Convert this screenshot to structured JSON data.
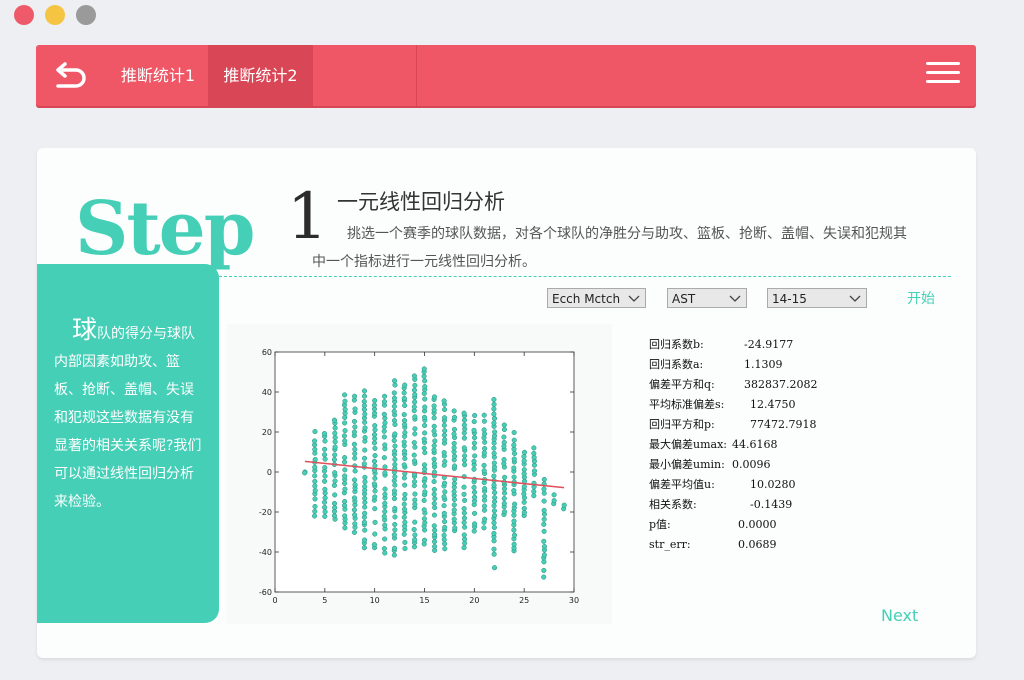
{
  "nav": {
    "tabs": [
      {
        "label": "推断统计1"
      },
      {
        "label": "推断统计2"
      }
    ]
  },
  "step": {
    "word": "Step",
    "number": "1",
    "title": "一元线性回归分析",
    "description": "挑选一个赛季的球队数据，对各个球队的净胜分与助攻、篮板、抢断、盖帽、失误和犯规其中一个指标进行一元线性回归分析。"
  },
  "side": {
    "first_char": "球",
    "text_rest": "队的得分与球队内部因素如助攻、篮板、抢断、盖帽、失误和犯规这些数据有没有显著的相关关系呢?我们可以通过线性回归分析来检验。"
  },
  "controls": {
    "match": "Ecch Mctch",
    "stat": "AST",
    "season": "14-15",
    "start": "开始"
  },
  "stats": [
    {
      "label": "回归系数b:",
      "value": "-24.9177"
    },
    {
      "label": "回归系数a:",
      "value": "1.1309"
    },
    {
      "label": "偏差平方和q:",
      "value": "382837.2082"
    },
    {
      "label": "平均标准偏差s:",
      "value": "12.4750"
    },
    {
      "label": "回归平方和p:",
      "value": "77472.7918"
    },
    {
      "label": "最大偏差umax:",
      "value": "44.6168"
    },
    {
      "label": "最小偏差umin:",
      "value": "0.0096"
    },
    {
      "label": "偏差平均值u:",
      "value": "10.0280"
    },
    {
      "label": "相关系数:",
      "value": "-0.1439"
    },
    {
      "label": "p值:",
      "value": "0.0000"
    },
    {
      "label": "str_err:",
      "value": "0.0689"
    }
  ],
  "next": "Next",
  "colors": {
    "primary": "#ef5666",
    "accent": "#45cfb6"
  },
  "chart_data": {
    "type": "scatter",
    "xlim": [
      0,
      30
    ],
    "ylim": [
      -60,
      60
    ],
    "xticks": [
      0,
      5,
      10,
      15,
      20,
      25,
      30
    ],
    "yticks": [
      60,
      40,
      20,
      0,
      -20,
      -40,
      -60
    ],
    "point_color": "#45cfb6",
    "regression_line": {
      "x": [
        3,
        29
      ],
      "y": [
        5.3,
        -7.8
      ],
      "color": "#e0505a"
    },
    "series": [
      {
        "x": 3,
        "y_min": 0,
        "y_max": 0
      },
      {
        "x": 4,
        "y_min": -22,
        "y_max": 20
      },
      {
        "x": 5,
        "y_min": -22,
        "y_max": 24
      },
      {
        "x": 6,
        "y_min": -24,
        "y_max": 26
      },
      {
        "x": 7,
        "y_min": -28,
        "y_max": 38
      },
      {
        "x": 8,
        "y_min": -30,
        "y_max": 38
      },
      {
        "x": 9,
        "y_min": -38,
        "y_max": 40
      },
      {
        "x": 10,
        "y_min": -38,
        "y_max": 36
      },
      {
        "x": 11,
        "y_min": -40,
        "y_max": 38
      },
      {
        "x": 12,
        "y_min": -42,
        "y_max": 46
      },
      {
        "x": 13,
        "y_min": -38,
        "y_max": 44
      },
      {
        "x": 14,
        "y_min": -38,
        "y_max": 48
      },
      {
        "x": 15,
        "y_min": -36,
        "y_max": 52
      },
      {
        "x": 16,
        "y_min": -42,
        "y_max": 38
      },
      {
        "x": 17,
        "y_min": -38,
        "y_max": 36
      },
      {
        "x": 18,
        "y_min": -32,
        "y_max": 30
      },
      {
        "x": 19,
        "y_min": -38,
        "y_max": 30
      },
      {
        "x": 20,
        "y_min": -30,
        "y_max": 28
      },
      {
        "x": 21,
        "y_min": -28,
        "y_max": 28
      },
      {
        "x": 22,
        "y_min": -48,
        "y_max": 36
      },
      {
        "x": 23,
        "y_min": -24,
        "y_max": 26
      },
      {
        "x": 24,
        "y_min": -40,
        "y_max": 20
      },
      {
        "x": 25,
        "y_min": -22,
        "y_max": 10
      },
      {
        "x": 26,
        "y_min": -12,
        "y_max": 12
      },
      {
        "x": 27,
        "y_min": -52,
        "y_max": -4
      },
      {
        "x": 28,
        "y_min": -16,
        "y_max": -12
      },
      {
        "x": 29,
        "y_min": -18,
        "y_max": -16
      }
    ]
  }
}
